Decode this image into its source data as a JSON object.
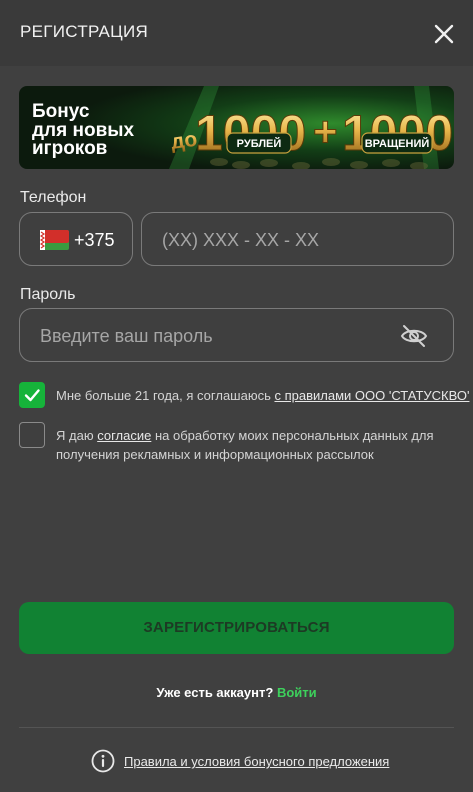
{
  "header": {
    "title": "РЕГИСТРАЦИЯ"
  },
  "banner": {
    "line1": "Бонус",
    "line2": "для новых",
    "line3": "игроков",
    "prefix": "до",
    "amount1": "1000",
    "plus": "+",
    "amount2": "1000",
    "tag1": "РУБЛЕЙ",
    "tag2": "ВРАЩЕНИЙ"
  },
  "phone": {
    "label": "Телефон",
    "country_code": "+375",
    "flag": "belarus-flag",
    "placeholder": "(XX) XXX - XX - XX"
  },
  "password": {
    "label": "Пароль",
    "placeholder": "Введите ваш пароль",
    "toggle_icon": "eye-hidden-icon"
  },
  "agreements": [
    {
      "checked": true,
      "text": "Мне больше 21 года, я соглашаюсь ",
      "link": "с правилами ООО 'СТАТУСКВО'"
    },
    {
      "checked": false,
      "text_before": "Я даю ",
      "link": "согласие",
      "text_after_line1": " на обработку моих персональных данных для",
      "text_line2": "получения рекламных и информационных рассылок"
    }
  ],
  "submit": {
    "label": "ЗАРЕГИСТРИРОВАТЬСЯ"
  },
  "login": {
    "question": "Уже есть аккаунт?",
    "link": "Войти"
  },
  "terms": {
    "icon": "info-icon",
    "label": "Правила и условия бонусного предложения"
  },
  "colors": {
    "background": "#404040",
    "header": "#3a3a3a",
    "accent_green": "#3dd15c",
    "button_green": "#118233",
    "checkbox_green": "#16b33a"
  }
}
